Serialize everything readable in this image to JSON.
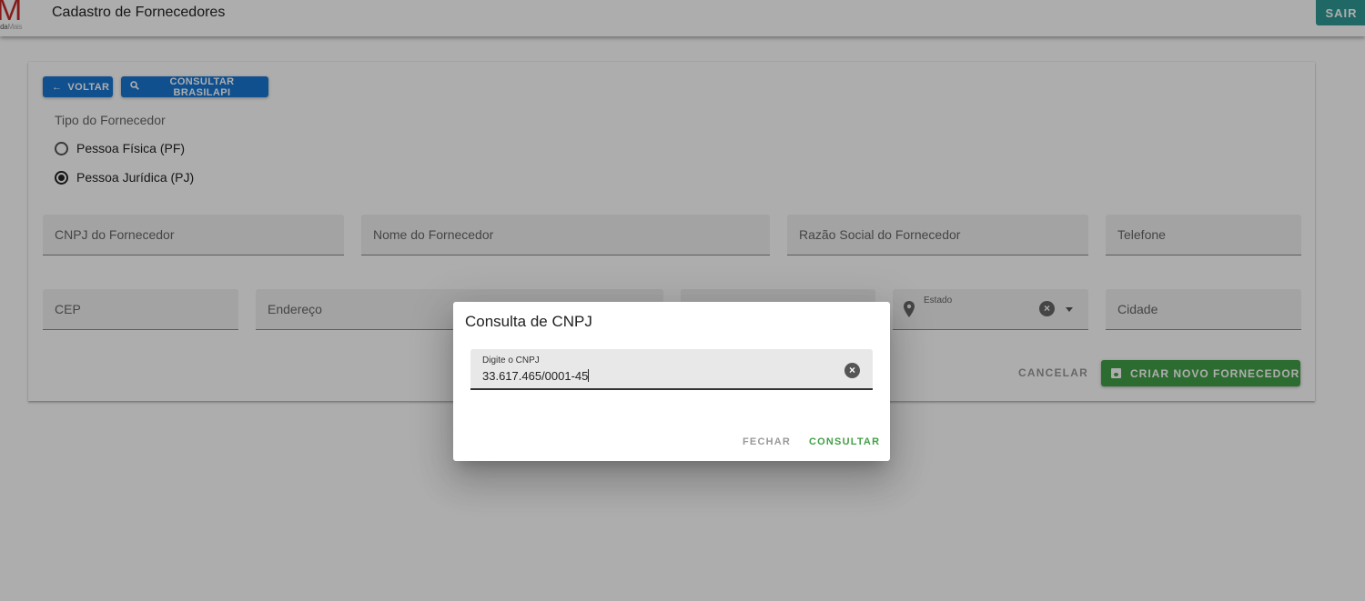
{
  "app": {
    "logo_letter": "M",
    "logo_sub_a": "nda",
    "logo_sub_b": "Mais",
    "title": "Cadastro de Fornecedores",
    "logout_label": "SAIR"
  },
  "actions": {
    "back_label": "VOLTAR",
    "brasilapi_label": "CONSULTAR BRASILAPI"
  },
  "supplier_type": {
    "label": "Tipo do Fornecedor",
    "options": [
      "Pessoa Física (PF)",
      "Pessoa Jurídica (PJ)"
    ],
    "selected": "Pessoa Jurídica (PJ)"
  },
  "fields": {
    "cnpj": "CNPJ do Fornecedor",
    "nome": "Nome do Fornecedor",
    "razao": "Razão Social do Fornecedor",
    "telefone": "Telefone",
    "cep": "CEP",
    "endereco": "Endereço",
    "estado": "Estado",
    "cidade": "Cidade"
  },
  "form_buttons": {
    "cancel_label": "CANCELAR",
    "create_label": "CRIAR NOVO FORNECEDOR"
  },
  "dialog": {
    "title": "Consulta de CNPJ",
    "input_label": "Digite o CNPJ",
    "input_value": "33.617.465/0001-45",
    "close_label": "FECHAR",
    "submit_label": "CONSULTAR"
  },
  "colors": {
    "primary_blue": "#1976d2",
    "success_green": "#43a047",
    "logout_teal": "#2e9a95",
    "logo_red": "#c62828"
  }
}
